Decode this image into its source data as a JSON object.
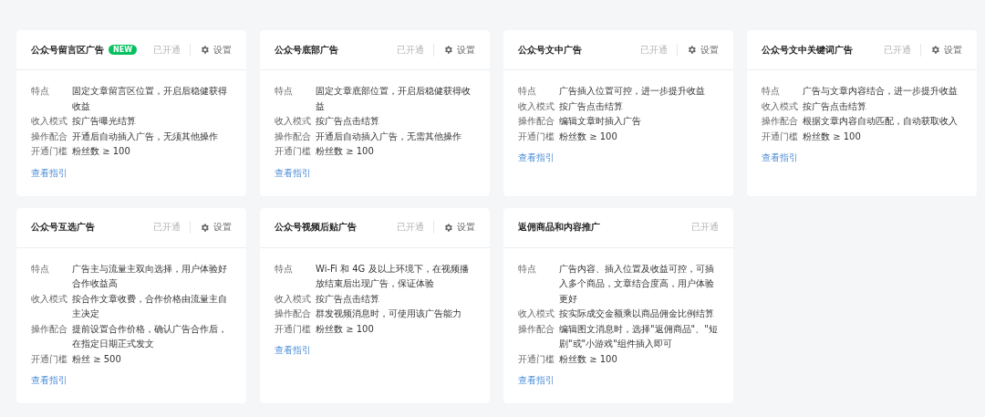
{
  "cards": [
    {
      "title": "公众号留言区广告",
      "badge": "NEW",
      "status": "已开通",
      "settings": "设置",
      "rows": [
        {
          "label": "特点",
          "value": "固定文章留言区位置，开启后稳健获得收益"
        },
        {
          "label": "收入模式",
          "value": "按广告曝光结算"
        },
        {
          "label": "操作配合",
          "value": "开通后自动插入广告，无须其他操作"
        },
        {
          "label": "开通门槛",
          "value": "粉丝数 ≥ 100"
        }
      ],
      "link": "查看指引"
    },
    {
      "title": "公众号底部广告",
      "status": "已开通",
      "settings": "设置",
      "rows": [
        {
          "label": "特点",
          "value": "固定文章底部位置，开启后稳健获得收益"
        },
        {
          "label": "收入模式",
          "value": "按广告点击结算"
        },
        {
          "label": "操作配合",
          "value": "开通后自动插入广告，无需其他操作"
        },
        {
          "label": "开通门槛",
          "value": "粉丝数 ≥ 100"
        }
      ],
      "link": "查看指引"
    },
    {
      "title": "公众号文中广告",
      "status": "已开通",
      "settings": "设置",
      "rows": [
        {
          "label": "特点",
          "value": "广告插入位置可控，进一步提升收益"
        },
        {
          "label": "收入模式",
          "value": "按广告点击结算"
        },
        {
          "label": "操作配合",
          "value": "编辑文章时插入广告"
        },
        {
          "label": "开通门槛",
          "value": "粉丝数 ≥ 100"
        }
      ],
      "link": "查看指引"
    },
    {
      "title": "公众号文中关键词广告",
      "status": "已开通",
      "settings": "设置",
      "rows": [
        {
          "label": "特点",
          "value": "广告与文章内容结合，进一步提升收益"
        },
        {
          "label": "收入模式",
          "value": "按广告点击结算"
        },
        {
          "label": "操作配合",
          "value": "根据文章内容自动匹配，自动获取收入"
        },
        {
          "label": "开通门槛",
          "value": "粉丝数 ≥ 100"
        }
      ],
      "link": "查看指引"
    },
    {
      "title": "公众号互选广告",
      "status": "已开通",
      "settings": "设置",
      "rows": [
        {
          "label": "特点",
          "value": "广告主与流量主双向选择，用户体验好合作收益高"
        },
        {
          "label": "收入模式",
          "value": "按合作文章收费，合作价格由流量主自主决定"
        },
        {
          "label": "操作配合",
          "value": "提前设置合作价格，确认广告合作后，在指定日期正式发文"
        },
        {
          "label": "开通门槛",
          "value": "粉丝 ≥ 500"
        }
      ],
      "link": "查看指引"
    },
    {
      "title": "公众号视频后贴广告",
      "status": "已开通",
      "settings": "设置",
      "rows": [
        {
          "label": "特点",
          "value": "Wi-Fi 和 4G 及以上环境下，在视频播放结束后出现广告，保证体验"
        },
        {
          "label": "收入模式",
          "value": "按广告点击结算"
        },
        {
          "label": "操作配合",
          "value": "群发视频消息时，可使用该广告能力"
        },
        {
          "label": "开通门槛",
          "value": "粉丝数 ≥ 100"
        }
      ],
      "link": "查看指引"
    },
    {
      "title": "返佣商品和内容推广",
      "status": "已开通",
      "rows": [
        {
          "label": "特点",
          "value": "广告内容、插入位置及收益可控，可插入多个商品，文章结合度高，用户体验更好"
        },
        {
          "label": "收入模式",
          "value": "按实际成交金额乘以商品佣金比例结算"
        },
        {
          "label": "操作配合",
          "value": "编辑图文消息时，选择\"返佣商品\"、\"短剧\"或\"小游戏\"组件插入即可"
        },
        {
          "label": "开通门槛",
          "value": "粉丝数 ≥ 100"
        }
      ],
      "link": "查看指引"
    }
  ]
}
